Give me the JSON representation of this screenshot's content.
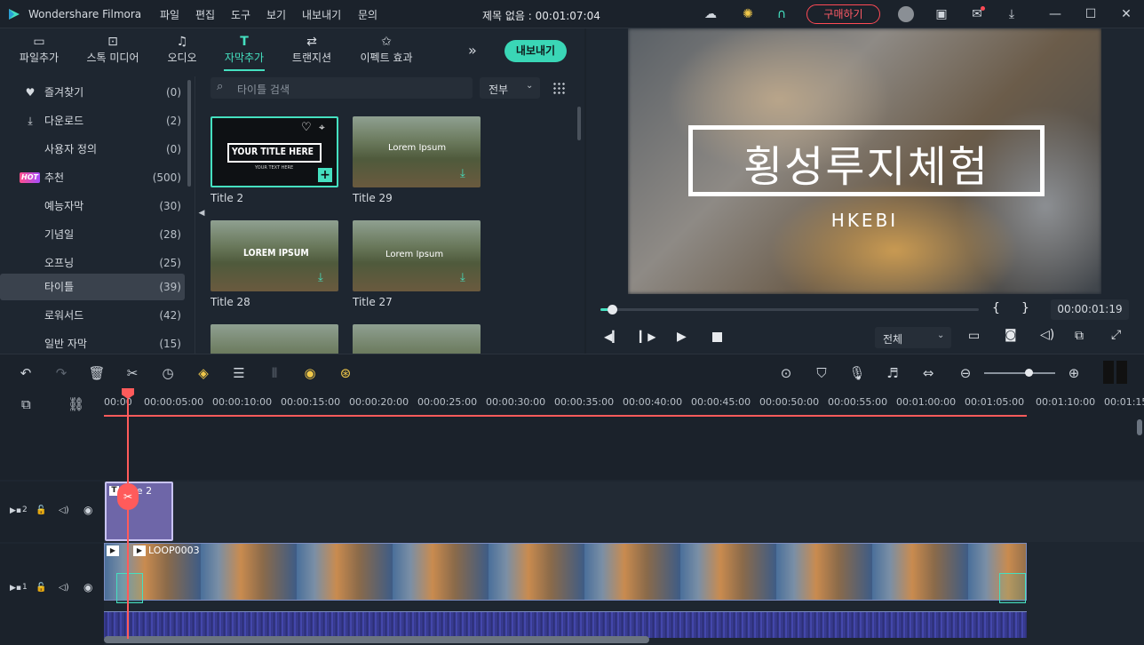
{
  "app": {
    "name": "Wondershare Filmora",
    "project_title": "제목 없음 : 00:01:07:04"
  },
  "menu": [
    "파일",
    "편집",
    "도구",
    "보기",
    "내보내기",
    "문의"
  ],
  "titlebar": {
    "buy_label": "구매하기"
  },
  "tabs": [
    {
      "label": "파일추가",
      "icon": "folder-icon"
    },
    {
      "label": "스톡 미디어",
      "icon": "stock-media-icon"
    },
    {
      "label": "오디오",
      "icon": "music-note-icon"
    },
    {
      "label": "자막추가",
      "icon": "text-t-icon",
      "active": true
    },
    {
      "label": "트랜지션",
      "icon": "transition-icon"
    },
    {
      "label": "이펙트 효과",
      "icon": "effects-icon"
    }
  ],
  "export_label": "내보내기",
  "categories": [
    {
      "label": "즐겨찾기",
      "count": "(0)",
      "icon": "heart-icon"
    },
    {
      "label": "다운로드",
      "count": "(2)",
      "icon": "download-icon"
    },
    {
      "label": "사용자 정의",
      "count": "(0)"
    },
    {
      "label": "추천",
      "count": "(500)",
      "badge": "HOT"
    },
    {
      "label": "예능자막",
      "count": "(30)"
    },
    {
      "label": "기념일",
      "count": "(28)"
    },
    {
      "label": "오프닝",
      "count": "(25)"
    },
    {
      "label": "타이틀",
      "count": "(39)",
      "selected": true
    },
    {
      "label": "로워서드",
      "count": "(42)"
    },
    {
      "label": "일반 자막",
      "count": "(15)"
    }
  ],
  "search": {
    "placeholder": "타이틀 검색"
  },
  "filter": {
    "value": "전부"
  },
  "titles": [
    {
      "label": "Title 2",
      "thumb_text": "YOUR TITLE HERE",
      "thumb_sub": "YOUR TEXT HERE"
    },
    {
      "label": "Title 29",
      "thumb_text": "Lorem Ipsum"
    },
    {
      "label": "Title 28",
      "thumb_text": "LOREM IPSUM"
    },
    {
      "label": "Title 27",
      "thumb_text": "Lorem Ipsum"
    }
  ],
  "preview": {
    "title_text": "횡성루지체험",
    "subtitle_text": "HKEBI",
    "timecode": "00:00:01:19",
    "quality": "전체",
    "progress": 0.03
  },
  "timeline": {
    "ticks": [
      "00:00",
      "00:00:05:00",
      "00:00:10:00",
      "00:00:15:00",
      "00:00:20:00",
      "00:00:25:00",
      "00:00:30:00",
      "00:00:35:00",
      "00:00:40:00",
      "00:00:45:00",
      "00:00:50:00",
      "00:00:55:00",
      "00:01:00:00",
      "00:01:05:00",
      "00:01:10:00",
      "00:01:15"
    ],
    "title_clip": "Title 2",
    "video_clip": "LOOP0003",
    "track2": "2",
    "track1": "1"
  },
  "colors": {
    "accent": "#45e0c0",
    "playhead": "#ff5b5b",
    "buy": "#ff4a55",
    "title_clip": "#6e66a8"
  }
}
